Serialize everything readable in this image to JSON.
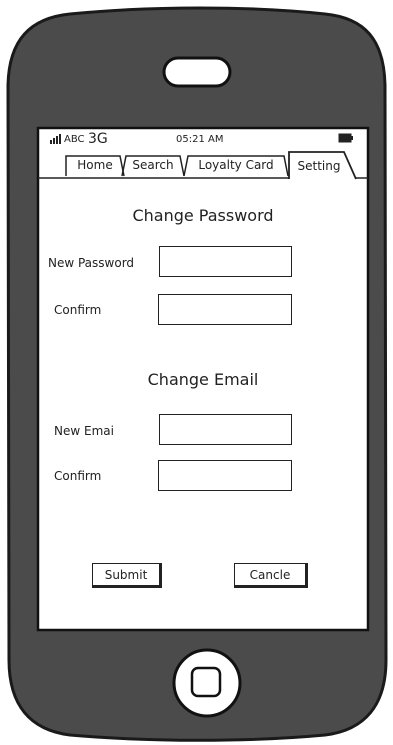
{
  "status_bar": {
    "carrier": "ABC",
    "network": "3G",
    "time": "05:21 AM"
  },
  "tabs": [
    {
      "label": "Home"
    },
    {
      "label": "Search"
    },
    {
      "label": "Loyalty Card"
    },
    {
      "label": "Setting"
    }
  ],
  "active_tab": "Setting",
  "password_section": {
    "title": "Change Password",
    "new_label": "New Password",
    "new_value": "",
    "confirm_label": "Confirm",
    "confirm_value": ""
  },
  "email_section": {
    "title": "Change Email",
    "new_label": "New Emai",
    "new_value": "",
    "confirm_label": "Confirm",
    "confirm_value": ""
  },
  "actions": {
    "submit_label": "Submit",
    "cancel_label": "Cancle"
  },
  "icons": {
    "signal": "signal-bars-icon",
    "battery": "battery-icon",
    "speaker": "speaker-slot-icon",
    "home": "home-button-icon"
  }
}
